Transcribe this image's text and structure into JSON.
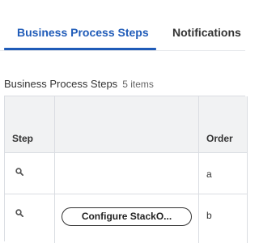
{
  "tabs": [
    {
      "label": "Business Process Steps",
      "active": true
    },
    {
      "label": "Notifications",
      "active": false
    }
  ],
  "grid": {
    "title": "Business Process Steps",
    "count": "5 items",
    "headers": {
      "step": "Step",
      "task": "",
      "order": "Order"
    },
    "rows": [
      {
        "order": "a",
        "task_button": ""
      },
      {
        "order": "b",
        "task_button": "Configure StackO..."
      }
    ]
  },
  "colors": {
    "accent": "#1f5bb8",
    "header_bg": "#f1f2f3",
    "border": "#dadde2"
  },
  "icons": {
    "row_action": "search-icon"
  }
}
